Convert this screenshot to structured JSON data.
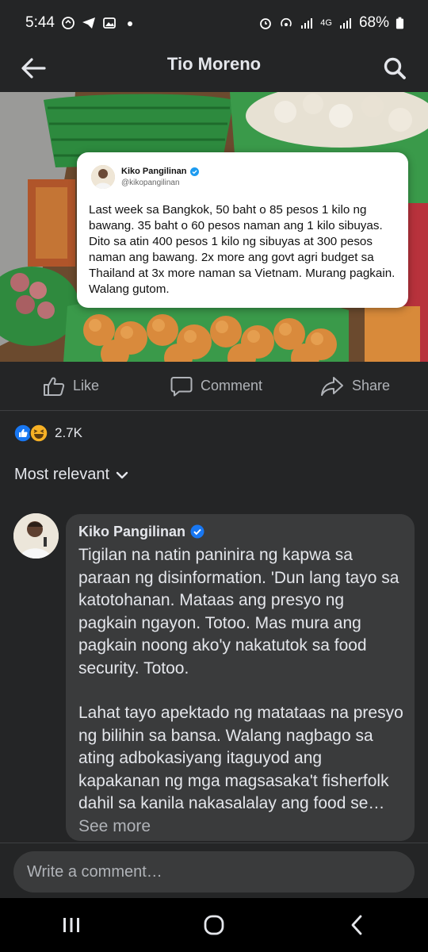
{
  "status_bar": {
    "time": "5:44",
    "network": "4G",
    "battery": "68%"
  },
  "header": {
    "title": "Tio Moreno"
  },
  "tweet": {
    "name": "Kiko Pangilinan",
    "handle": "@kikopangilinan",
    "text": "Last week sa Bangkok, 50 baht o 85 pesos 1 kilo ng bawang. 35 baht o 60 pesos naman ang 1 kilo sibuyas. Dito sa atin 400 pesos 1 kilo ng sibuyas at 300 pesos naman ang bawang. 2x more ang govt agri budget sa Thailand at 3x more naman sa Vietnam. Murang pagkain. Walang gutom."
  },
  "actions": {
    "like": "Like",
    "comment": "Comment",
    "share": "Share"
  },
  "reactions": {
    "count": "2.7K",
    "icons": [
      "like-reaction",
      "haha-reaction"
    ]
  },
  "sort": {
    "label": "Most relevant"
  },
  "comment": {
    "author": "Kiko Pangilinan",
    "paragraph1": "Tigilan na natin paninira ng kapwa sa paraan ng disinformation. 'Dun lang tayo sa katotohanan. Mataas ang presyo ng pagkain ngayon. Totoo. Mas mura ang pagkain noong ako'y nakatutok sa food security. Totoo.",
    "paragraph2": "Lahat tayo apektado ng matataas na presyo ng bilihin sa bansa. Walang nagbago sa ating adbokasiyang itaguyod ang kapakanan ng mga magsasaka't fisherfolk dahil sa kanila nakasalalay ang food se…",
    "see_more": "See more"
  },
  "composer": {
    "placeholder": "Write a comment…"
  },
  "colors": {
    "background": "#242526",
    "bubble": "#3a3b3c",
    "text_primary": "#e4e6eb",
    "text_secondary": "#b0b3b8",
    "verified": "#1877f2"
  }
}
